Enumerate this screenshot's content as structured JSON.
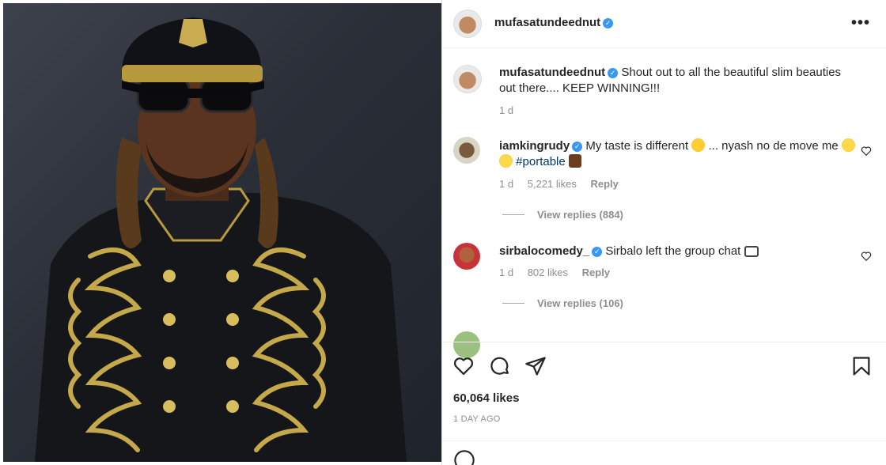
{
  "post": {
    "username": "mufasatundeednut",
    "caption": {
      "username": "mufasatundeednut",
      "text": "Shout out to all the beautiful slim beauties out there.... KEEP WINNING!!!",
      "time": "1 d"
    }
  },
  "comments": [
    {
      "username": "iamkingrudy",
      "text_a": "My taste is different",
      "text_b": "... nyash no de move me",
      "hashtag": "#portable",
      "time": "1 d",
      "likes": "5,221 likes",
      "reply_label": "Reply",
      "view_replies": "View replies (884)"
    },
    {
      "username": "sirbalocomedy_",
      "text": "Sirbalo left the group chat",
      "time": "1 d",
      "likes": "802 likes",
      "reply_label": "Reply",
      "view_replies": "View replies (106)"
    }
  ],
  "actions": {
    "likes": "60,064 likes",
    "date": "1 DAY AGO"
  },
  "icons": {
    "more": "more-options-icon",
    "like": "heart-icon",
    "comment": "comment-icon",
    "share": "share-icon",
    "save": "bookmark-icon"
  },
  "colors": {
    "verified": "#3897f0",
    "hashtag": "#00376b",
    "muted": "#8e8e8e"
  }
}
